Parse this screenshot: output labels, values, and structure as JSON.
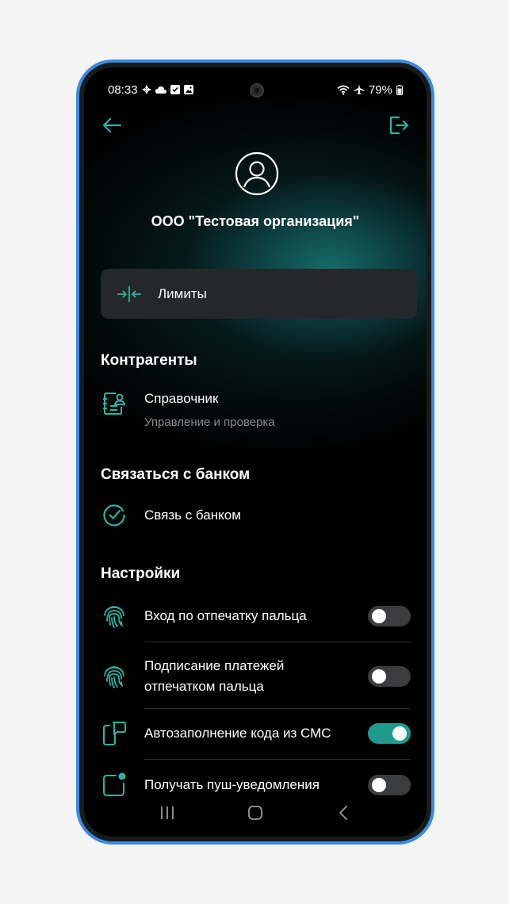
{
  "status": {
    "time": "08:33",
    "battery": "79%"
  },
  "profile": {
    "org_name": "ООО \"Тестовая организация\""
  },
  "limits": {
    "label": "Лимиты"
  },
  "counterparties": {
    "title": "Контрагенты",
    "directory_label": "Справочник",
    "directory_sub": "Управление и проверка"
  },
  "contact": {
    "title": "Связаться с банком",
    "bank_label": "Связь с банком"
  },
  "settings": {
    "title": "Настройки",
    "items": [
      {
        "label": "Вход по отпечатку пальца",
        "enabled": false
      },
      {
        "label": "Подписание платежей отпечатком пальца",
        "enabled": false
      },
      {
        "label": "Автозаполнение кода из СМС",
        "enabled": true
      },
      {
        "label": "Получать пуш-уведомления",
        "enabled": false
      }
    ]
  },
  "colors": {
    "accent": "#2bb3a3",
    "toggle_on": "#1f9b8e",
    "card": "#24282a",
    "frame": "#3a8ae0"
  },
  "icons": {
    "back": "arrow-left-icon",
    "logout": "logout-icon",
    "avatar": "user-circle-icon",
    "limits": "limits-icon",
    "directory": "contacts-book-icon",
    "bank": "check-circle-icon",
    "fingerprint": "fingerprint-icon",
    "sms": "sms-phone-icon",
    "push": "notification-icon"
  }
}
